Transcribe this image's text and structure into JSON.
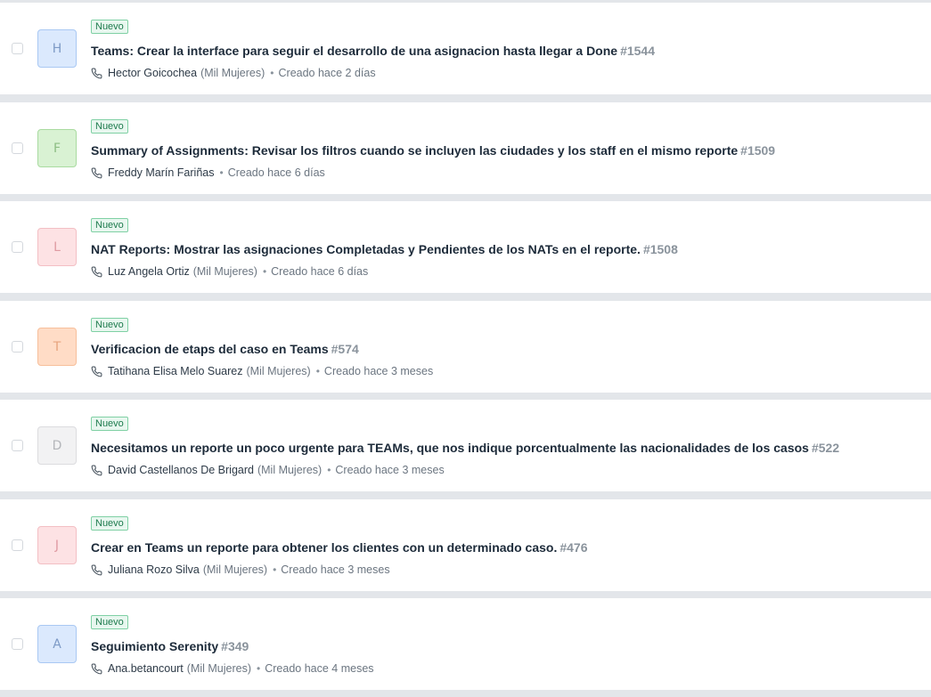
{
  "tickets": [
    {
      "avatar_letter": "H",
      "avatar_bg": "#dbe9fd",
      "avatar_border": "#a9c8f3",
      "avatar_fg": "#7d9ac6",
      "status": "Nuevo",
      "subject": "Teams: Crear la interface para seguir el desarrollo de una asignacion hasta llegar a Done",
      "id": "#1544",
      "requester": "Hector Goicochea",
      "company": "(Mil Mujeres)",
      "created": "Creado hace 2 días"
    },
    {
      "avatar_letter": "F",
      "avatar_bg": "#d9f2d3",
      "avatar_border": "#a9dba0",
      "avatar_fg": "#8dbd83",
      "status": "Nuevo",
      "subject": "Summary of Assignments: Revisar los filtros cuando se incluyen las ciudades y los staff en el mismo reporte",
      "id": "#1509",
      "requester": "Freddy Marín Fariñas",
      "company": "",
      "created": "Creado hace 6 días"
    },
    {
      "avatar_letter": "L",
      "avatar_bg": "#fde2e4",
      "avatar_border": "#f3bfc4",
      "avatar_fg": "#df9aa2",
      "status": "Nuevo",
      "subject": "NAT Reports: Mostrar las asignaciones Completadas y Pendientes de los NATs en el reporte.",
      "id": "#1508",
      "requester": "Luz Angela Ortiz",
      "company": "(Mil Mujeres)",
      "created": "Creado hace 6 días"
    },
    {
      "avatar_letter": "T",
      "avatar_bg": "#ffdcc6",
      "avatar_border": "#f7bf9b",
      "avatar_fg": "#e7a57d",
      "status": "Nuevo",
      "subject": "Verificacion de etaps del caso en Teams",
      "id": "#574",
      "requester": "Tatihana Elisa Melo Suarez",
      "company": "(Mil Mujeres)",
      "created": "Creado hace 3 meses"
    },
    {
      "avatar_letter": "D",
      "avatar_bg": "#f2f2f3",
      "avatar_border": "#dcdcdf",
      "avatar_fg": "#b4b6ba",
      "status": "Nuevo",
      "subject": "Necesitamos un reporte un poco urgente para TEAMs, que nos indique porcentualmente las nacionalidades de los casos",
      "id": "#522",
      "requester": "David Castellanos De Brigard",
      "company": "(Mil Mujeres)",
      "created": "Creado hace 3 meses"
    },
    {
      "avatar_letter": "J",
      "avatar_bg": "#fde2e4",
      "avatar_border": "#f3bfc4",
      "avatar_fg": "#df9aa2",
      "status": "Nuevo",
      "subject": "Crear en Teams un reporte para obtener los clientes con un determinado caso.",
      "id": "#476",
      "requester": "Juliana Rozo Silva",
      "company": "(Mil Mujeres)",
      "created": "Creado hace 3 meses"
    },
    {
      "avatar_letter": "A",
      "avatar_bg": "#dbe9fd",
      "avatar_border": "#a9c8f3",
      "avatar_fg": "#7d9ac6",
      "status": "Nuevo",
      "subject": "Seguimiento Serenity",
      "id": "#349",
      "requester": "Ana.betancourt",
      "company": "(Mil Mujeres)",
      "created": "Creado hace 4 meses"
    }
  ],
  "icons": {
    "channel": "phone-icon"
  }
}
